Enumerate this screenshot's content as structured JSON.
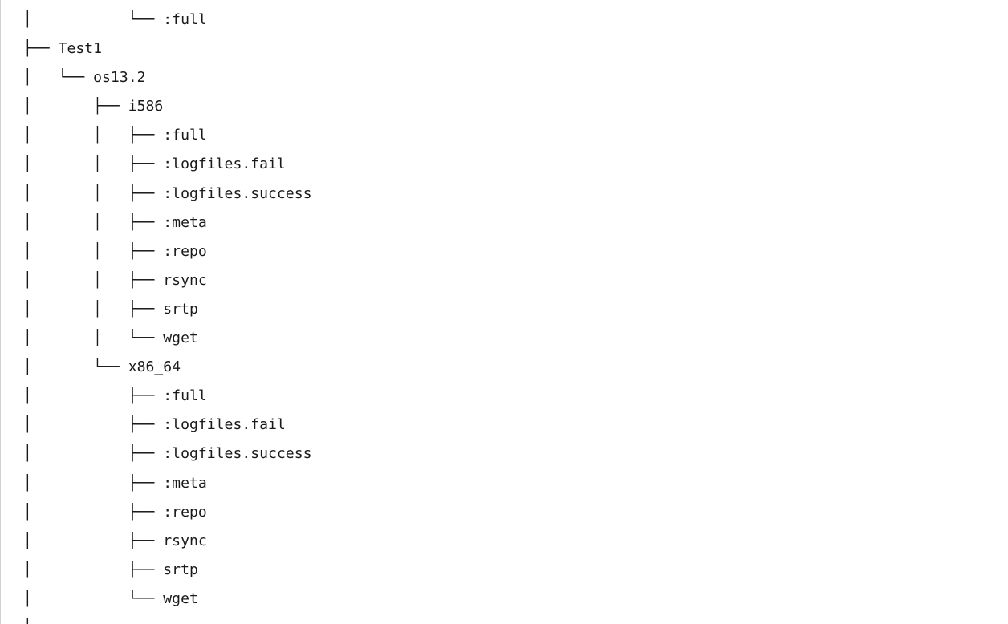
{
  "tree": {
    "lines": [
      "│           └── :full",
      "├── Test1",
      "│   └── os13.2",
      "│       ├── i586",
      "│       │   ├── :full",
      "│       │   ├── :logfiles.fail",
      "│       │   ├── :logfiles.success",
      "│       │   ├── :meta",
      "│       │   ├── :repo",
      "│       │   ├── rsync",
      "│       │   ├── srtp",
      "│       │   └── wget",
      "│       └── x86_64",
      "│           ├── :full",
      "│           ├── :logfiles.fail",
      "│           ├── :logfiles.success",
      "│           ├── :meta",
      "│           ├── :repo",
      "│           ├── rsync",
      "│           ├── srtp",
      "│           └── wget",
      "│"
    ]
  }
}
